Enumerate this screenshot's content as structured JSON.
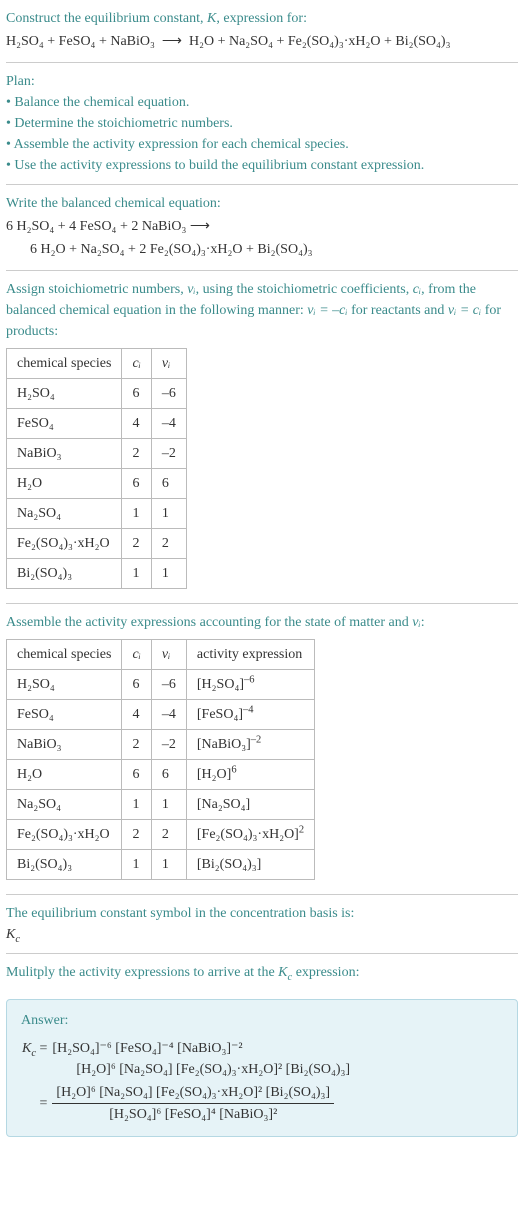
{
  "intro": {
    "line1_prefix": "Construct the equilibrium constant, ",
    "line1_K": "K",
    "line1_suffix": ", expression for:",
    "equation_lhs": "H₂SO₄ + FeSO₄ + NaBiO₃",
    "equation_arrow": "⟶",
    "equation_rhs": "H₂O + Na₂SO₄ + Fe₂(SO₄)₃·xH₂O + Bi₂(SO₄)₃"
  },
  "plan": {
    "heading": "Plan:",
    "b1": "• Balance the chemical equation.",
    "b2": "• Determine the stoichiometric numbers.",
    "b3": "• Assemble the activity expression for each chemical species.",
    "b4": "• Use the activity expressions to build the equilibrium constant expression."
  },
  "balanced": {
    "heading": "Write the balanced chemical equation:",
    "line1": "6 H₂SO₄ + 4 FeSO₄ + 2 NaBiO₃  ⟶",
    "line2": "6 H₂O + Na₂SO₄ + 2 Fe₂(SO₄)₃·xH₂O + Bi₂(SO₄)₃"
  },
  "stoich_intro": {
    "prefix": "Assign stoichiometric numbers, ",
    "vi": "νᵢ",
    "mid1": ", using the stoichiometric coefficients, ",
    "ci": "cᵢ",
    "mid2": ", from the balanced chemical equation in the following manner: ",
    "rel1": "νᵢ = –cᵢ",
    "mid3": " for reactants and ",
    "rel2": "νᵢ = cᵢ",
    "suffix": " for products:"
  },
  "stoich_table": {
    "h_species": "chemical species",
    "h_ci": "cᵢ",
    "h_vi": "νᵢ",
    "rows": [
      {
        "species": "H₂SO₄",
        "ci": "6",
        "vi": "–6"
      },
      {
        "species": "FeSO₄",
        "ci": "4",
        "vi": "–4"
      },
      {
        "species": "NaBiO₃",
        "ci": "2",
        "vi": "–2"
      },
      {
        "species": "H₂O",
        "ci": "6",
        "vi": "6"
      },
      {
        "species": "Na₂SO₄",
        "ci": "1",
        "vi": "1"
      },
      {
        "species": "Fe₂(SO₄)₃·xH₂O",
        "ci": "2",
        "vi": "2"
      },
      {
        "species": "Bi₂(SO₄)₃",
        "ci": "1",
        "vi": "1"
      }
    ]
  },
  "activity_intro": {
    "prefix": "Assemble the activity expressions accounting for the state of matter and ",
    "vi": "νᵢ",
    "suffix": ":"
  },
  "activity_table": {
    "h_species": "chemical species",
    "h_ci": "cᵢ",
    "h_vi": "νᵢ",
    "h_act": "activity expression",
    "rows": [
      {
        "species": "H₂SO₄",
        "ci": "6",
        "vi": "–6",
        "act_base": "[H₂SO₄]",
        "act_exp": "–6"
      },
      {
        "species": "FeSO₄",
        "ci": "4",
        "vi": "–4",
        "act_base": "[FeSO₄]",
        "act_exp": "–4"
      },
      {
        "species": "NaBiO₃",
        "ci": "2",
        "vi": "–2",
        "act_base": "[NaBiO₃]",
        "act_exp": "–2"
      },
      {
        "species": "H₂O",
        "ci": "6",
        "vi": "6",
        "act_base": "[H₂O]",
        "act_exp": "6"
      },
      {
        "species": "Na₂SO₄",
        "ci": "1",
        "vi": "1",
        "act_base": "[Na₂SO₄]",
        "act_exp": ""
      },
      {
        "species": "Fe₂(SO₄)₃·xH₂O",
        "ci": "2",
        "vi": "2",
        "act_base": "[Fe₂(SO₄)₃·xH₂O]",
        "act_exp": "2"
      },
      {
        "species": "Bi₂(SO₄)₃",
        "ci": "1",
        "vi": "1",
        "act_base": "[Bi₂(SO₄)₃]",
        "act_exp": ""
      }
    ]
  },
  "kc_symbol": {
    "line1": "The equilibrium constant symbol in the concentration basis is:",
    "line2_k": "K",
    "line2_c": "c"
  },
  "multiply": {
    "prefix": "Mulitply the activity expressions to arrive at the ",
    "k": "K",
    "c": "c",
    "suffix": " expression:"
  },
  "answer": {
    "label": "Answer:",
    "kc_k": "K",
    "kc_c": "c",
    "eq": "=",
    "line1": "[H₂SO₄]⁻⁶ [FeSO₄]⁻⁴ [NaBiO₃]⁻²",
    "line2": "[H₂O]⁶ [Na₂SO₄] [Fe₂(SO₄)₃·xH₂O]² [Bi₂(SO₄)₃]",
    "frac_num": "[H₂O]⁶ [Na₂SO₄] [Fe₂(SO₄)₃·xH₂O]² [Bi₂(SO₄)₃]",
    "frac_den": "[H₂SO₄]⁶ [FeSO₄]⁴ [NaBiO₃]²"
  }
}
